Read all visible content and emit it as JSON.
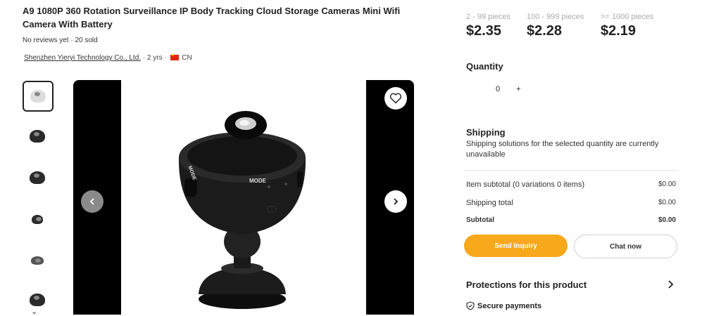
{
  "product": {
    "title": "A9 1080P 360 Rotation Surveillance IP Body Tracking Cloud Storage Cameras Mini Wifi Camera With Battery",
    "meta": "No reviews yet · 20 sold",
    "supplier_name": "Shenzhen Yieryi Technology Co., Ltd.",
    "supplier_years": "· 2 yrs ·",
    "country": "CN"
  },
  "gallery": {
    "thumbnails": [
      "thumb-1",
      "thumb-2",
      "thumb-3",
      "thumb-4",
      "thumb-5",
      "thumb-6"
    ],
    "selected_index": 0,
    "icons": {
      "prev": "chevron-left-icon",
      "next": "chevron-right-icon",
      "favorite": "heart-icon",
      "more": "chevron-down-icon"
    },
    "camera_labels": {
      "mode": "MODE",
      "mode2": "MODE"
    }
  },
  "pricing": [
    {
      "range": "2 - 99 pieces",
      "price": "$2.35"
    },
    {
      "range": "100 - 999 pieces",
      "price": "$2.28"
    },
    {
      "range": ">= 1000 pieces",
      "price": "$2.19"
    }
  ],
  "quantity": {
    "label": "Quantity",
    "value": "0",
    "increment": "+"
  },
  "shipping": {
    "heading": "Shipping",
    "message": "Shipping solutions for the selected quantity are currently unavailable"
  },
  "summary": {
    "item_subtotal_label": "Item subtotal (0 variations 0 items)",
    "item_subtotal_value": "$0.00",
    "shipping_total_label": "Shipping total",
    "shipping_total_value": "$0.00",
    "subtotal_label": "Subtotal",
    "subtotal_value": "$0.00"
  },
  "actions": {
    "send_inquiry": "Send Inquiry",
    "chat_now": "Chat now"
  },
  "protections": {
    "heading": "Protections for this product",
    "secure_payments": "Secure payments"
  },
  "colors": {
    "accent": "#f7a81b",
    "price_tier_muted": "#aaaaaa",
    "flag": "#de2910"
  }
}
